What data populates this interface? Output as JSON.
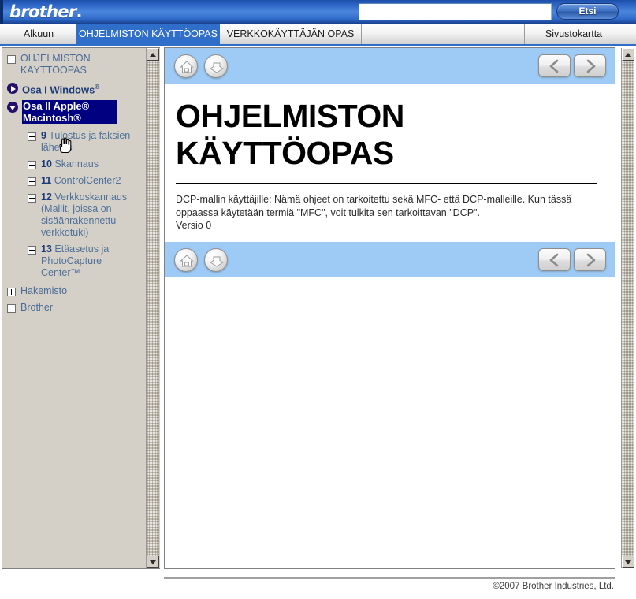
{
  "header": {
    "logo_text": "brother",
    "logo_dot": ".",
    "search_value": "",
    "search_placeholder": "",
    "search_button_label": "Etsi"
  },
  "tabs": [
    {
      "label": "Alkuun",
      "active": false
    },
    {
      "label": "OHJELMISTON KÄYTTÖOPAS",
      "active": true
    },
    {
      "label": "VERKKOKÄYTTÄJÄN OPAS",
      "active": false
    },
    {
      "label": "Sivustokartta",
      "active": false
    }
  ],
  "sidebar": {
    "items": [
      {
        "label": "OHJELMISTON KÄYTTÖOPAS",
        "toggle": "box",
        "level": 0,
        "style": "root"
      },
      {
        "label": "Osa I Windows",
        "sup": "®",
        "toggle": "circle-right",
        "level": 0,
        "style": "part"
      },
      {
        "label": "Osa II Apple® Macintosh®",
        "toggle": "circle-down",
        "level": 0,
        "style": "part-selected"
      },
      {
        "num": "9",
        "label": "Tulostus ja faksien lähetys",
        "toggle": "box-plus",
        "level": 1,
        "style": "chapter"
      },
      {
        "num": "10",
        "label": "Skannaus",
        "toggle": "box-plus",
        "level": 1,
        "style": "chapter"
      },
      {
        "num": "11",
        "label": "ControlCenter2",
        "toggle": "box-plus",
        "level": 1,
        "style": "chapter"
      },
      {
        "num": "12",
        "label": "Verkkoskannaus (Mallit, joissa on sisäänrakennettu verkkotuki)",
        "toggle": "box-plus",
        "level": 1,
        "style": "chapter"
      },
      {
        "num": "13",
        "label": "Etäasetus ja PhotoCapture Center™",
        "toggle": "box-plus",
        "level": 1,
        "style": "chapter"
      },
      {
        "label": "Hakemisto",
        "toggle": "box-plus",
        "level": 0,
        "style": "root"
      },
      {
        "label": "Brother",
        "toggle": "box",
        "level": 0,
        "style": "root"
      }
    ]
  },
  "navbar": {
    "home_icon": "home-icon",
    "book_icon": "book-icon",
    "prev_icon": "chevron-left-icon",
    "next_icon": "chevron-right-icon"
  },
  "document": {
    "title_line1": "OHJELMISTON",
    "title_line2": "KÄYTTÖOPAS",
    "body": "DCP-mallin käyttäjille: Nämä ohjeet on tarkoitettu sekä MFC- että DCP-malleille. Kun tässä oppaassa käytetään termiä \"MFC\", voit tulkita sen tarkoittavan \"DCP\".\nVersio 0"
  },
  "footer": {
    "copyright": "©2007 Brother Industries, Ltd."
  },
  "colors": {
    "brand_blue": "#2f6fc9",
    "navbar_blue": "#9ecbf5",
    "selected_navy": "#000080",
    "sidebar_gray": "#d4d0c8",
    "link_blue": "#3a5d8f"
  }
}
